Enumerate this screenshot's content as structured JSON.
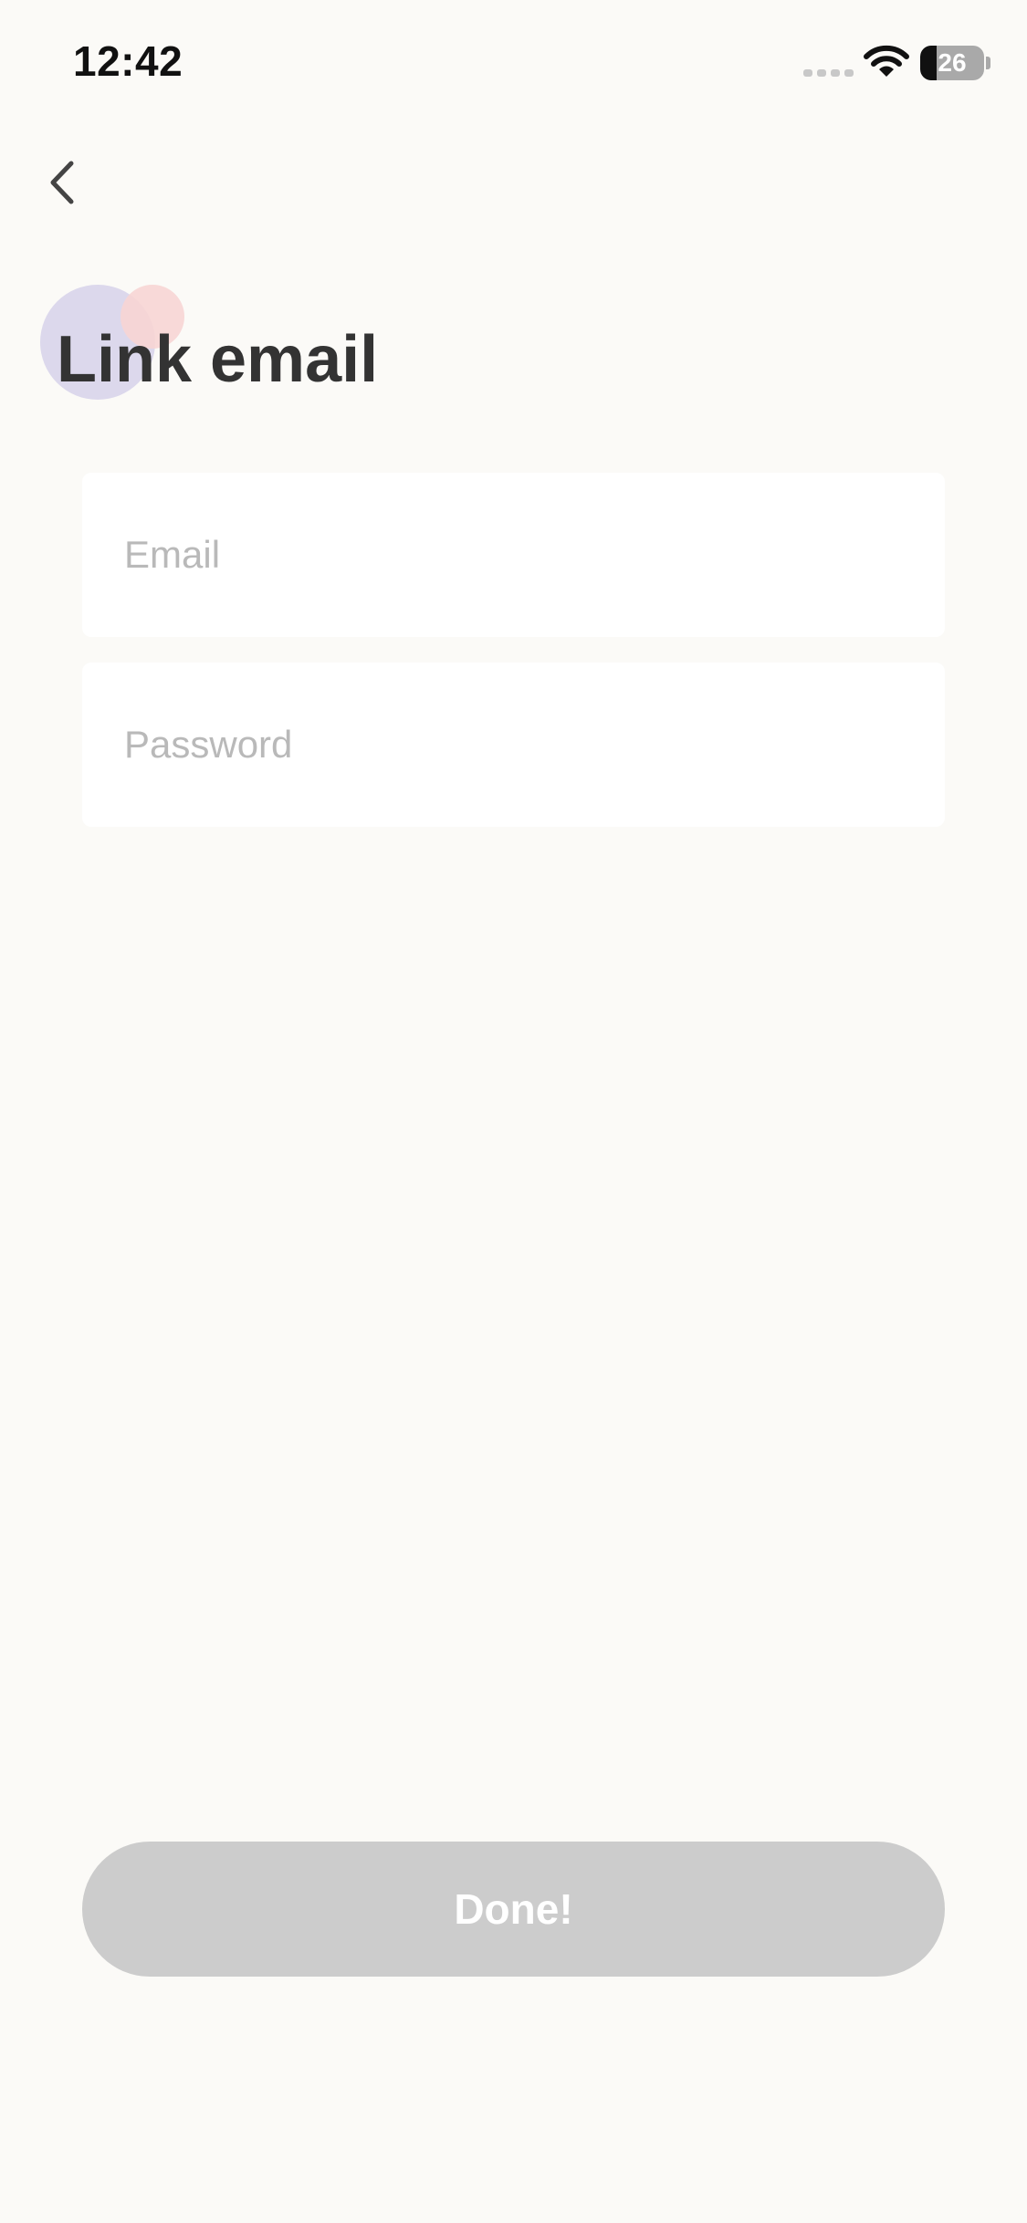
{
  "status_bar": {
    "time": "12:42",
    "battery_level": "26",
    "battery_fraction": 0.26,
    "signal_icon": "cellular-signal-icon",
    "wifi_icon": "wifi-icon",
    "battery_icon": "battery-icon"
  },
  "navigation": {
    "back_icon": "chevron-left-icon"
  },
  "header": {
    "title": "Link email"
  },
  "form": {
    "email_placeholder": "Email",
    "email_value": "",
    "password_placeholder": "Password",
    "password_value": ""
  },
  "actions": {
    "done_label": "Done!"
  },
  "colors": {
    "background": "#fbfaf7",
    "title_text": "#333333",
    "placeholder_text": "#b9b9b9",
    "button_disabled": "#cccccc",
    "button_text": "#ffffff",
    "decor_purple": "#dcd8ec",
    "decor_pink": "#f7d5d4"
  }
}
